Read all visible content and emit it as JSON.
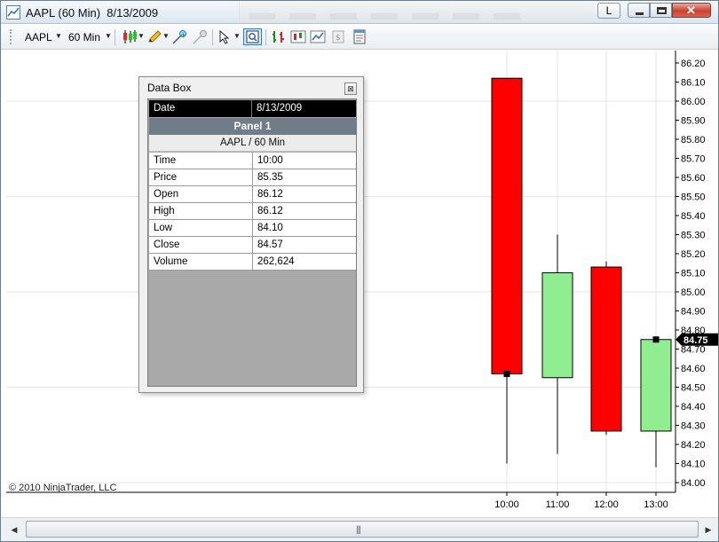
{
  "window": {
    "title": "AAPL (60 Min)  8/13/2009",
    "link_button_label": "L"
  },
  "toolbar": {
    "instrument": "AAPL",
    "interval": "60 Min",
    "icons": [
      "chart-style-icon",
      "drawing-pencil-icon",
      "add-indicator-icon",
      "strategy-icon",
      "cursor-icon",
      "data-box-icon",
      "bar-chart-icon",
      "candlestick-icon",
      "line-chart-icon",
      "currency-icon",
      "properties-icon"
    ]
  },
  "chart": {
    "copyright": "© 2010 NinjaTrader, LLC",
    "current_price_label": "84.75",
    "y_ticks": [
      "86.20",
      "86.10",
      "86.00",
      "85.90",
      "85.80",
      "85.70",
      "85.60",
      "85.50",
      "85.40",
      "85.30",
      "85.20",
      "85.10",
      "85.00",
      "84.90",
      "84.80",
      "84.70",
      "84.60",
      "84.50",
      "84.40",
      "84.30",
      "84.20",
      "84.10",
      "84.00"
    ],
    "x_ticks": [
      "10:00",
      "11:00",
      "12:00",
      "13:00"
    ],
    "colors": {
      "up": "#90ee90",
      "down": "#ff0000",
      "wick": "#000000",
      "grid": "#e6e6e6"
    }
  },
  "chart_data": {
    "type": "candlestick",
    "instrument": "AAPL",
    "interval": "60 Min",
    "date": "8/13/2009",
    "x": [
      "10:00",
      "11:00",
      "12:00",
      "13:00"
    ],
    "open": [
      86.12,
      84.55,
      85.13,
      84.27
    ],
    "high": [
      86.12,
      85.3,
      85.16,
      84.75
    ],
    "low": [
      84.1,
      84.15,
      84.25,
      84.08
    ],
    "close": [
      84.57,
      85.1,
      84.27,
      84.75
    ],
    "ylim": [
      83.98,
      86.25
    ]
  },
  "databox": {
    "title": "Data Box",
    "date_label": "Date",
    "date_value": "8/13/2009",
    "panel_label": "Panel 1",
    "series_label": "AAPL / 60 Min",
    "rows": [
      {
        "label": "Time",
        "value": "10:00"
      },
      {
        "label": "Price",
        "value": "85.35"
      },
      {
        "label": "Open",
        "value": "86.12"
      },
      {
        "label": "High",
        "value": "86.12"
      },
      {
        "label": "Low",
        "value": "84.10"
      },
      {
        "label": "Close",
        "value": "84.57"
      },
      {
        "label": "Volume",
        "value": "262,624"
      }
    ]
  }
}
